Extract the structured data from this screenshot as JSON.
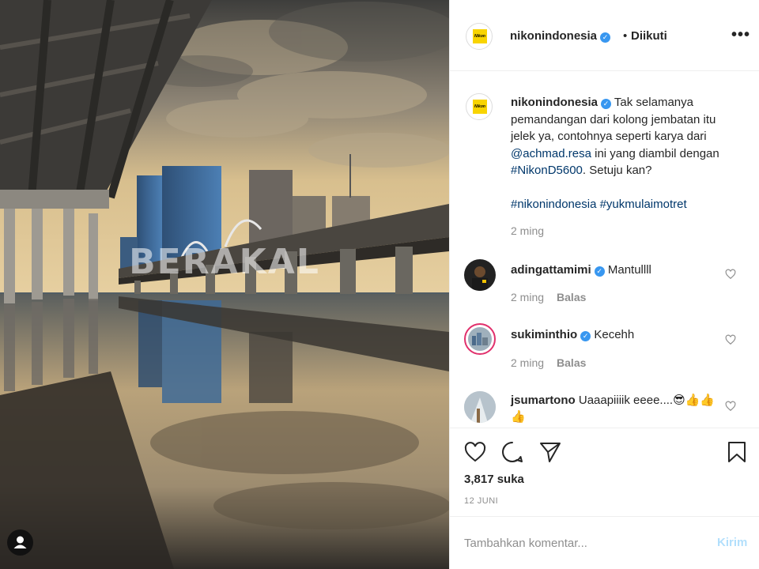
{
  "photo": {
    "watermark": "BERAKAL",
    "alt_icon": "user-tag-icon"
  },
  "header": {
    "username": "nikonindonesia",
    "separator": "•",
    "follow_status": "Diikuti",
    "more": "•••",
    "avatar_text": "Nikon"
  },
  "caption": {
    "username": "nikonindonesia",
    "text_1": "Tak selamanya pemandangan dari kolong jembatan itu jelek ya, contohnya seperti karya dari",
    "mention": "@achmad.resa",
    "text_2": "ini yang diambil dengan",
    "hashtag_1": "#NikonD5600",
    "text_3": ". Setuju kan?",
    "hashtag_2": "#nikonindonesia",
    "hashtag_3": "#yukmulaimotret",
    "time": "2 ming"
  },
  "comments": [
    {
      "username": "adingattamimi",
      "text": "Mantullll",
      "time": "2 ming",
      "reply": "Balas"
    },
    {
      "username": "sukiminthio",
      "text": "Kecehh",
      "time": "2 ming",
      "reply": "Balas"
    },
    {
      "username": "jsumartono",
      "text": "Uaaapiiiik eeee....😎👍👍👍"
    }
  ],
  "actions": {
    "likes": "3,817 suka",
    "date": "12 JUNI"
  },
  "add_comment": {
    "placeholder": "Tambahkan komentar...",
    "send": "Kirim"
  },
  "colors": {
    "link": "#00376b",
    "verified": "#3897f0",
    "muted": "#8e8e8e",
    "send_disabled": "#b2dffc"
  }
}
